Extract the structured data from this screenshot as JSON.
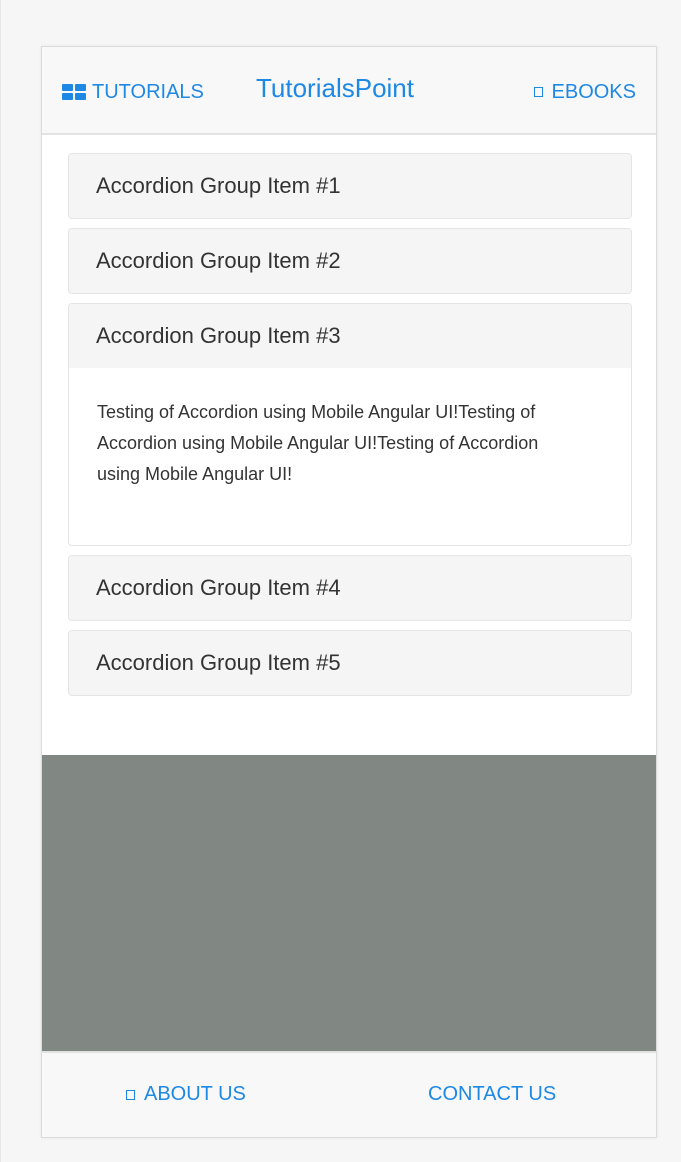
{
  "navbar": {
    "left_label": "TUTORIALS",
    "left_icon": "grid-icon",
    "brand": "TutorialsPoint",
    "right_label": "EBOOKS",
    "right_icon": "square-icon"
  },
  "accordion": {
    "items": [
      {
        "title": "Accordion Group Item #1",
        "expanded": false
      },
      {
        "title": "Accordion Group Item #2",
        "expanded": false
      },
      {
        "title": "Accordion Group Item #3",
        "expanded": true,
        "body": "Testing of Accordion using Mobile Angular UI!Testing of Accordion using Mobile Angular UI!Testing of Accordion using Mobile Angular UI!"
      },
      {
        "title": "Accordion Group Item #4",
        "expanded": false
      },
      {
        "title": "Accordion Group Item #5",
        "expanded": false
      }
    ]
  },
  "footer": {
    "about_label": "ABOUT US",
    "about_icon": "square-icon",
    "contact_label": "CONTACT US"
  },
  "colors": {
    "accent": "#1e88e5",
    "content_gray": "#818884",
    "panel_heading": "#f5f5f5"
  }
}
